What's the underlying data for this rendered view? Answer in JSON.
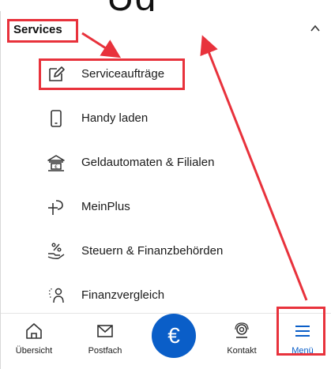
{
  "top_crop_text": "Üg",
  "section": {
    "title": "Services"
  },
  "menu_items": [
    {
      "label": "Serviceaufträge",
      "icon": "edit-icon"
    },
    {
      "label": "Handy laden",
      "icon": "phone-icon"
    },
    {
      "label": "Geldautomaten & Filialen",
      "icon": "bank-icon"
    },
    {
      "label": "MeinPlus",
      "icon": "plus-icon"
    },
    {
      "label": "Steuern & Finanzbehörden",
      "icon": "percent-hand-icon"
    },
    {
      "label": "Finanzvergleich",
      "icon": "person-compare-icon"
    }
  ],
  "bottom_nav": {
    "overview": "Übersicht",
    "mailbox": "Postfach",
    "euro_symbol": "€",
    "contact": "Kontakt",
    "menu": "Menü"
  },
  "colors": {
    "accent": "#0a5ec8",
    "highlight": "#e8323c"
  }
}
